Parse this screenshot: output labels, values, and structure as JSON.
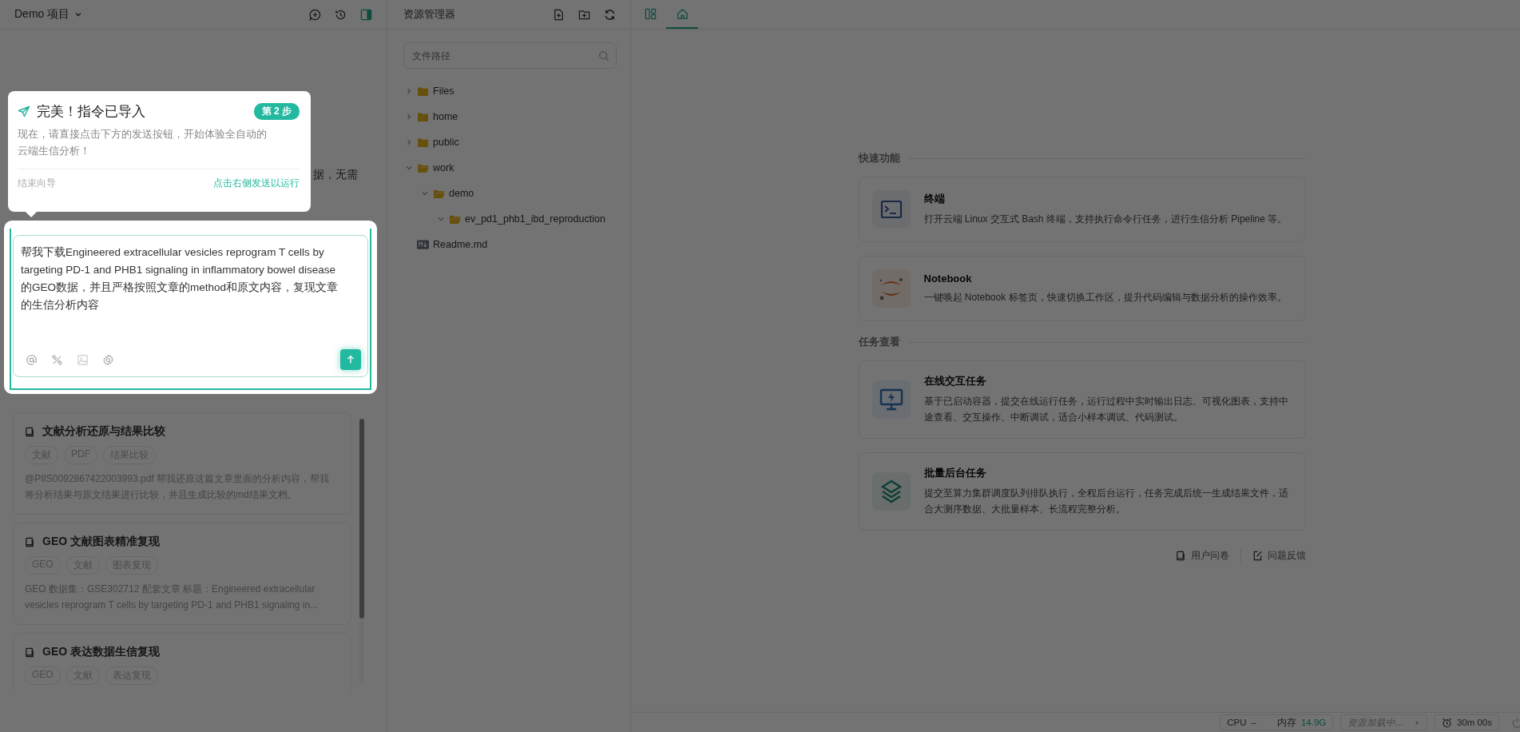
{
  "left_panel": {
    "project": "Demo 项目",
    "behind_text": "据，无需",
    "input": {
      "value": "帮我下载Engineered extracellular vesicles reprogram T cells by targeting PD-1 and PHB1 signaling in inflammatory bowel disease 的GEO数据，并且严格按照文章的method和原文内容，复现文章的生信分析内容"
    },
    "templates": [
      {
        "title": "文献分析还原与结果比较",
        "tags": [
          "文献",
          "PDF",
          "结果比较"
        ],
        "desc": "@PIIS0092867422003993.pdf 帮我还原这篇文章里面的分析内容，帮我将分析结果与原文结果进行比较，并且生成比较的md结果文档。"
      },
      {
        "title": "GEO 文献图表精准复现",
        "tags": [
          "GEO",
          "文献",
          "图表复现"
        ],
        "desc": "GEO 数据集：GSE302712 配套文章 标题：Engineered extracellular vesicles reprogram T cells by targeting PD-1 and PHB1 signaling in..."
      },
      {
        "title": "GEO 表达数据生信复现",
        "tags": [
          "GEO",
          "文献",
          "表达复现"
        ]
      }
    ]
  },
  "tour": {
    "title": "完美！指令已导入",
    "step": "第 2 步",
    "body": "现在，请直接点击下方的发送按钮，开始体验全自动的云端生信分析！",
    "skip": "结束向导",
    "hint": "点击右侧发送以运行"
  },
  "explorer": {
    "title": "资源管理器",
    "search": {
      "placeholder": "文件路径"
    },
    "tree": [
      {
        "name": "Files",
        "kind": "folder",
        "expanded": false
      },
      {
        "name": "home",
        "kind": "folder",
        "expanded": false
      },
      {
        "name": "public",
        "kind": "folder",
        "expanded": false
      },
      {
        "name": "work",
        "kind": "folder",
        "expanded": true,
        "children": [
          {
            "name": "demo",
            "kind": "folder",
            "expanded": true,
            "children": [
              {
                "name": "ev_pd1_phb1_ibd_reproduction",
                "kind": "folder",
                "expanded": true
              }
            ]
          }
        ]
      },
      {
        "name": "Readme.md",
        "kind": "markdown"
      }
    ]
  },
  "tabs": [
    {
      "kind": "layout",
      "selected": false
    },
    {
      "kind": "home",
      "selected": true
    }
  ],
  "home": {
    "sections": [
      {
        "title": "快速功能",
        "cards": [
          {
            "kind": "terminal",
            "title": "终端",
            "desc": "打开云端 Linux 交互式 Bash 终端，支持执行命令行任务，进行生信分析 Pipeline 等。"
          },
          {
            "kind": "jupyter",
            "title": "Notebook",
            "desc": "一键唤起 Notebook 标签页，快速切换工作区，提升代码编辑与数据分析的操作效率。"
          }
        ]
      },
      {
        "title": "任务查看",
        "cards": [
          {
            "kind": "monitor",
            "title": "在线交互任务",
            "desc": "基于已启动容器，提交在线运行任务，运行过程中实时输出日志、可视化图表，支持中途查看、交互操作、中断调试，适合小样本调试、代码测试。"
          },
          {
            "kind": "layers",
            "title": "批量后台任务",
            "desc": "提交至算力集群调度队列排队执行，全程后台运行，任务完成后统一生成结果文件，适合大测序数据、大批量样本、长流程完整分析。"
          }
        ]
      }
    ],
    "links": [
      {
        "kind": "survey",
        "label": "用户问卷"
      },
      {
        "kind": "feedback",
        "label": "问题反馈"
      }
    ]
  },
  "status_bar": {
    "cpu_label": "CPU",
    "cpu_value": "–",
    "mem_label": "内存",
    "mem_value": "14.9G",
    "resource": "资源加载中...",
    "timer": "30m 00s"
  }
}
